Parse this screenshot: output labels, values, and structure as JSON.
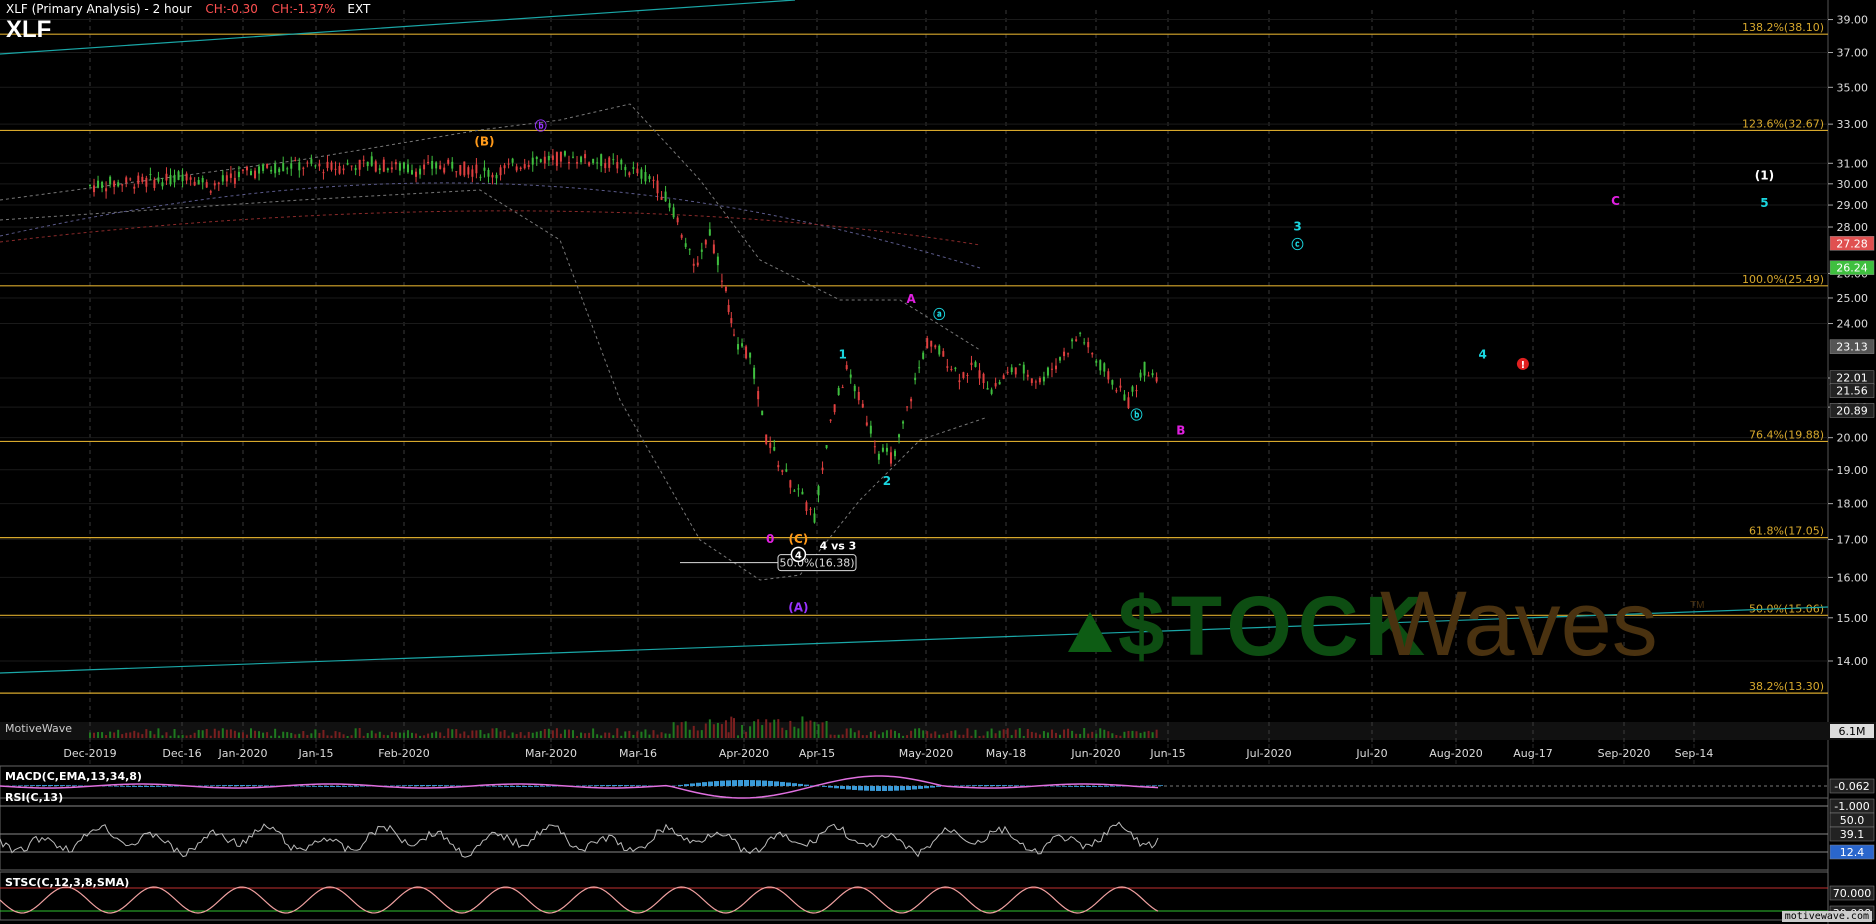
{
  "header": {
    "title": "XLF (Primary Analysis) - 2 hour",
    "change_abs": "CH:-0.30",
    "change_pct": "CH:-1.37%",
    "session": "EXT",
    "symbol": "XLF"
  },
  "watermark_left": "MotiveWave",
  "footer": "motivewave.com",
  "logo": {
    "text_left": "$TOCK",
    "text_right": "Waves",
    "tm": "TM"
  },
  "colors": {
    "background": "#000000",
    "up_candle": "#3fbf3f",
    "down_candle": "#e04040",
    "fib_line": "#d7a82c",
    "channel": "#1aa7a7",
    "macd_line": "#e070e0",
    "rsi_line": "#bbbbbb",
    "stoch_k": "#f0a0a0",
    "stoch_d": "#ffffff"
  },
  "chart_data": {
    "type": "candlestick",
    "x_ticks": [
      "Dec-2019",
      "Dec-16",
      "Jan-2020",
      "Jan-15",
      "Feb-2020",
      "Mar-2020",
      "Mar-16",
      "Apr-2020",
      "Apr-15",
      "May-2020",
      "May-18",
      "Jun-2020",
      "Jun-15",
      "Jul-2020",
      "Jul-20",
      "Aug-2020",
      "Aug-17",
      "Sep-2020",
      "Sep-14"
    ],
    "y_ticks": [
      "39.00",
      "37.00",
      "35.00",
      "33.00",
      "31.00",
      "30.00",
      "29.00",
      "28.00",
      "26.00",
      "25.00",
      "24.00",
      "22.00",
      "21.00",
      "20.00",
      "19.00",
      "18.00",
      "17.00",
      "16.00",
      "15.00",
      "14.00"
    ],
    "y_range": [
      12.7,
      39.6
    ],
    "y_scale": "log",
    "fib_levels": [
      {
        "label": "138.2%(38.10)",
        "value": 38.1
      },
      {
        "label": "123.6%(32.67)",
        "value": 32.67
      },
      {
        "label": "100.0%(25.49)",
        "value": 25.49
      },
      {
        "label": "76.4%(19.88)",
        "value": 19.88
      },
      {
        "label": "61.8%(17.05)",
        "value": 17.05
      },
      {
        "label": "50.0%(15.06)",
        "value": 15.06
      },
      {
        "label": "38.2%(13.30)",
        "value": 13.3
      }
    ],
    "price_tags": [
      {
        "text": "27.28",
        "value": 27.28,
        "color": "#e05050"
      },
      {
        "text": "26.24",
        "value": 26.24,
        "color": "#3fbf3f"
      },
      {
        "text": "23.13",
        "value": 23.13,
        "color": "#555555"
      },
      {
        "text": "22.01",
        "value": 22.01,
        "color": "#222222"
      },
      {
        "text": "21.56",
        "value": 21.56,
        "color": "#222222"
      },
      {
        "text": "20.89",
        "value": 20.89,
        "color": "#222222"
      }
    ],
    "volume_tag": "6.1M",
    "fib_box": {
      "label": "50.0%(16.38)",
      "value": 16.38
    },
    "annotation_note": "4 vs 3",
    "wave_labels": [
      {
        "text": "(B)",
        "date": 4.9,
        "value": 31.9,
        "color": "#ff9a1a"
      },
      {
        "text": "ⓑ",
        "date": 5.6,
        "value": 32.7,
        "color": "#9933ff"
      },
      {
        "text": "0",
        "date": 8.45,
        "value": 16.9,
        "color": "#e020e0"
      },
      {
        "text": "(C)",
        "date": 8.8,
        "value": 16.9,
        "color": "#ff9a1a"
      },
      {
        "text": "(A)",
        "date": 8.8,
        "value": 15.15,
        "color": "#9933ff"
      },
      {
        "text": "1",
        "date": 9.35,
        "value": 22.7,
        "color": "#1ad7e0"
      },
      {
        "text": "2",
        "date": 9.9,
        "value": 18.55,
        "color": "#1ad7e0"
      },
      {
        "text": "A",
        "date": 10.2,
        "value": 24.8,
        "color": "#e020e0"
      },
      {
        "text": "ⓐ",
        "date": 10.55,
        "value": 24.2,
        "color": "#1ad7e0"
      },
      {
        "text": "ⓑ",
        "date": 13.0,
        "value": 20.6,
        "color": "#1ad7e0"
      },
      {
        "text": "B",
        "date": 13.55,
        "value": 20.1,
        "color": "#e020e0"
      },
      {
        "text": "3",
        "date": 15.0,
        "value": 27.85,
        "color": "#1ad7e0"
      },
      {
        "text": "ⓒ",
        "date": 15.0,
        "value": 27.05,
        "color": "#1ad7e0"
      },
      {
        "text": "4",
        "date": 17.3,
        "value": 22.7,
        "color": "#1ad7e0"
      },
      {
        "text": "C",
        "date": 18.95,
        "value": 29.0,
        "color": "#e020e0"
      },
      {
        "text": "(1)",
        "date": 20.8,
        "value": 30.2,
        "color": "#ffffff"
      },
      {
        "text": "5",
        "date": 20.8,
        "value": 28.9,
        "color": "#1ad7e0"
      }
    ],
    "price_path": [
      [
        0.0,
        29.9
      ],
      [
        0.5,
        30.1
      ],
      [
        1.0,
        30.2
      ],
      [
        1.2,
        30.5
      ],
      [
        1.5,
        29.9
      ],
      [
        2.0,
        30.6
      ],
      [
        2.5,
        30.9
      ],
      [
        3.0,
        30.8
      ],
      [
        3.5,
        31.0
      ],
      [
        4.0,
        30.7
      ],
      [
        4.5,
        30.9
      ],
      [
        5.0,
        30.5
      ],
      [
        5.5,
        31.2
      ],
      [
        6.0,
        31.3
      ],
      [
        6.5,
        31.0
      ],
      [
        7.0,
        30.2
      ],
      [
        7.3,
        28.4
      ],
      [
        7.5,
        26.2
      ],
      [
        7.7,
        27.8
      ],
      [
        7.9,
        25.3
      ],
      [
        8.0,
        23.4
      ],
      [
        8.2,
        22.8
      ],
      [
        8.4,
        20.0
      ],
      [
        8.6,
        19.0
      ],
      [
        8.8,
        18.3
      ],
      [
        9.0,
        17.6
      ],
      [
        9.2,
        20.5
      ],
      [
        9.4,
        22.3
      ],
      [
        9.6,
        21.0
      ],
      [
        9.8,
        19.5
      ],
      [
        10.0,
        19.4
      ],
      [
        10.2,
        21.4
      ],
      [
        10.4,
        23.3
      ],
      [
        10.6,
        22.8
      ],
      [
        10.8,
        22.1
      ],
      [
        11.0,
        22.4
      ],
      [
        11.2,
        21.6
      ],
      [
        11.5,
        22.4
      ],
      [
        11.8,
        21.9
      ],
      [
        12.0,
        22.5
      ],
      [
        12.3,
        23.6
      ],
      [
        12.5,
        22.6
      ],
      [
        12.7,
        21.9
      ],
      [
        12.9,
        21.2
      ],
      [
        13.1,
        22.3
      ],
      [
        13.3,
        22.1
      ]
    ],
    "indicators": [
      {
        "name": "MACD(C,EMA,13,34,8)",
        "tags": [
          "-0.062",
          "-1.000"
        ]
      },
      {
        "name": "RSI(C,13)",
        "tags": [
          "50.0",
          "39.1",
          "12.4"
        ]
      },
      {
        "name": "STSC(C,12,3,8,SMA)",
        "tags": [
          "70.000",
          "30.000"
        ]
      }
    ]
  }
}
